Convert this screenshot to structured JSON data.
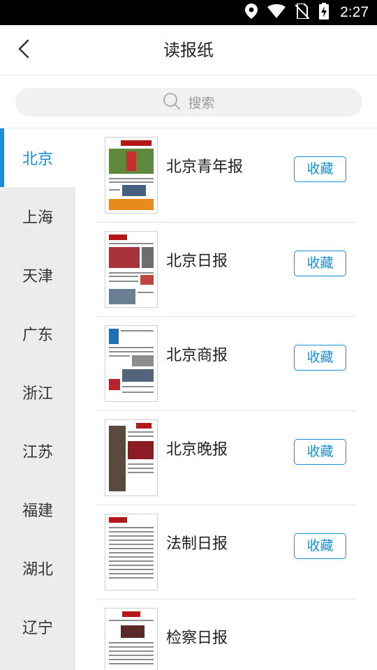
{
  "status_bar": {
    "time": "2:27",
    "icons": [
      "location-icon",
      "wifi-icon",
      "no-sim-icon",
      "battery-charging-icon"
    ]
  },
  "header": {
    "back_icon": "chevron-left-icon",
    "title": "读报纸"
  },
  "search": {
    "icon": "search-icon",
    "placeholder": "搜索"
  },
  "sidebar": {
    "active_index": 0,
    "items": [
      {
        "label": "北京"
      },
      {
        "label": "上海"
      },
      {
        "label": "天津"
      },
      {
        "label": "广东"
      },
      {
        "label": "浙江"
      },
      {
        "label": "江苏"
      },
      {
        "label": "福建"
      },
      {
        "label": "湖北"
      },
      {
        "label": "辽宁"
      }
    ]
  },
  "papers": [
    {
      "name": "北京青年报",
      "fav_label": "收藏"
    },
    {
      "name": "北京日报",
      "fav_label": "收藏"
    },
    {
      "name": "北京商报",
      "fav_label": "收藏"
    },
    {
      "name": "北京晚报",
      "fav_label": "收藏"
    },
    {
      "name": "法制日报",
      "fav_label": "收藏"
    },
    {
      "name": "检察日报",
      "fav_label": ""
    }
  ],
  "colors": {
    "accent": "#1a8fd8",
    "sidebar_bg": "#ececec",
    "status_bar_bg": "#000000"
  }
}
